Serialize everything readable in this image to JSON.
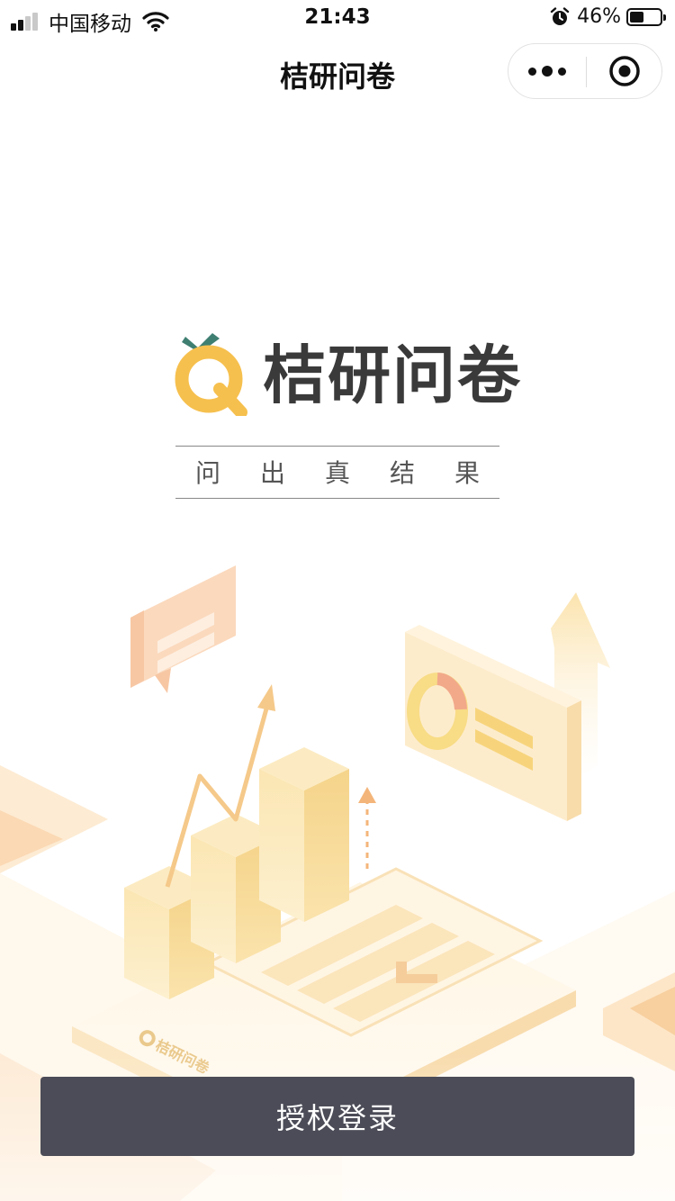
{
  "status_bar": {
    "carrier": "中国移动",
    "time": "21:43",
    "battery_percent": "46%",
    "battery_level": 0.46,
    "signal_bars_active": 2,
    "signal_bars_total": 4
  },
  "nav": {
    "title": "桔研问卷",
    "menu_icon": "more-dots-icon",
    "close_icon": "target-circle-icon"
  },
  "brand": {
    "name": "桔研问卷",
    "slogan": [
      "问",
      "出",
      "真",
      "结",
      "果"
    ],
    "logo_colors": {
      "ring": "#f6c04e",
      "leaf": "#3f7f72"
    }
  },
  "illustration": {
    "watermark_text": "桔研问卷"
  },
  "login_button": {
    "label": "授权登录",
    "background": "#4b4c57"
  }
}
